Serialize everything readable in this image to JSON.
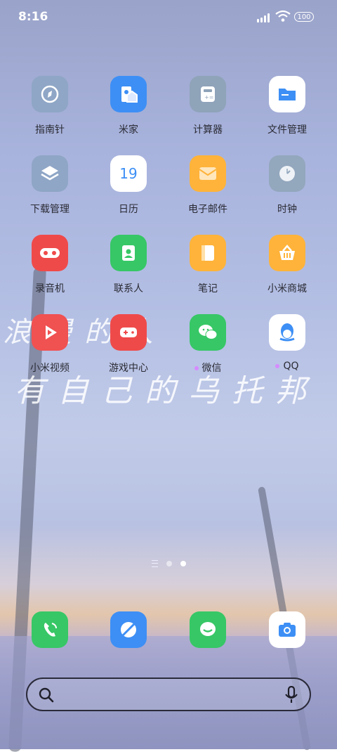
{
  "status": {
    "time": "8:16",
    "battery": "100"
  },
  "wallpaper_text": {
    "line1": "浪漫的人",
    "line2": "有自己的乌托邦"
  },
  "apps": [
    {
      "label": "指南针",
      "color": "#8fa6c6",
      "icon": "compass-icon"
    },
    {
      "label": "米家",
      "color": "#3d8ff5",
      "icon": "home-device-icon"
    },
    {
      "label": "计算器",
      "color": "#8fa3b9",
      "icon": "calculator-icon"
    },
    {
      "label": "文件管理",
      "color": "#ffffff",
      "icon": "folder-icon"
    },
    {
      "label": "下载管理",
      "color": "#8fa6c6",
      "icon": "layers-icon"
    },
    {
      "label": "日历",
      "color": "#ffffff",
      "icon": "calendar-icon",
      "number": "19"
    },
    {
      "label": "电子邮件",
      "color": "#ffb33a",
      "icon": "mail-icon"
    },
    {
      "label": "时钟",
      "color": "#93a7bd",
      "icon": "clock-icon"
    },
    {
      "label": "录音机",
      "color": "#ef4a4a",
      "icon": "recorder-icon"
    },
    {
      "label": "联系人",
      "color": "#37c766",
      "icon": "contacts-icon"
    },
    {
      "label": "笔记",
      "color": "#ffb33a",
      "icon": "notes-icon"
    },
    {
      "label": "小米商城",
      "color": "#ffb33a",
      "icon": "shopping-basket-icon"
    },
    {
      "label": "小米视频",
      "color": "#f05151",
      "icon": "play-icon"
    },
    {
      "label": "游戏中心",
      "color": "#ef4a4a",
      "icon": "gamepad-icon"
    },
    {
      "label": "微信",
      "color": "#37c766",
      "icon": "wechat-icon",
      "notify": true
    },
    {
      "label": "QQ",
      "color": "#ffffff",
      "icon": "qq-penguin-icon",
      "notify": true
    }
  ],
  "dock": [
    {
      "name": "phone",
      "color": "#37c766",
      "icon": "phone-icon"
    },
    {
      "name": "browser",
      "color": "#3d8ff5",
      "icon": "browser-icon"
    },
    {
      "name": "messages",
      "color": "#37c766",
      "icon": "message-icon"
    },
    {
      "name": "camera",
      "color": "#ffffff",
      "icon": "camera-icon"
    }
  ],
  "pager": {
    "pages": 2,
    "active": 2
  },
  "search": {
    "placeholder": ""
  }
}
